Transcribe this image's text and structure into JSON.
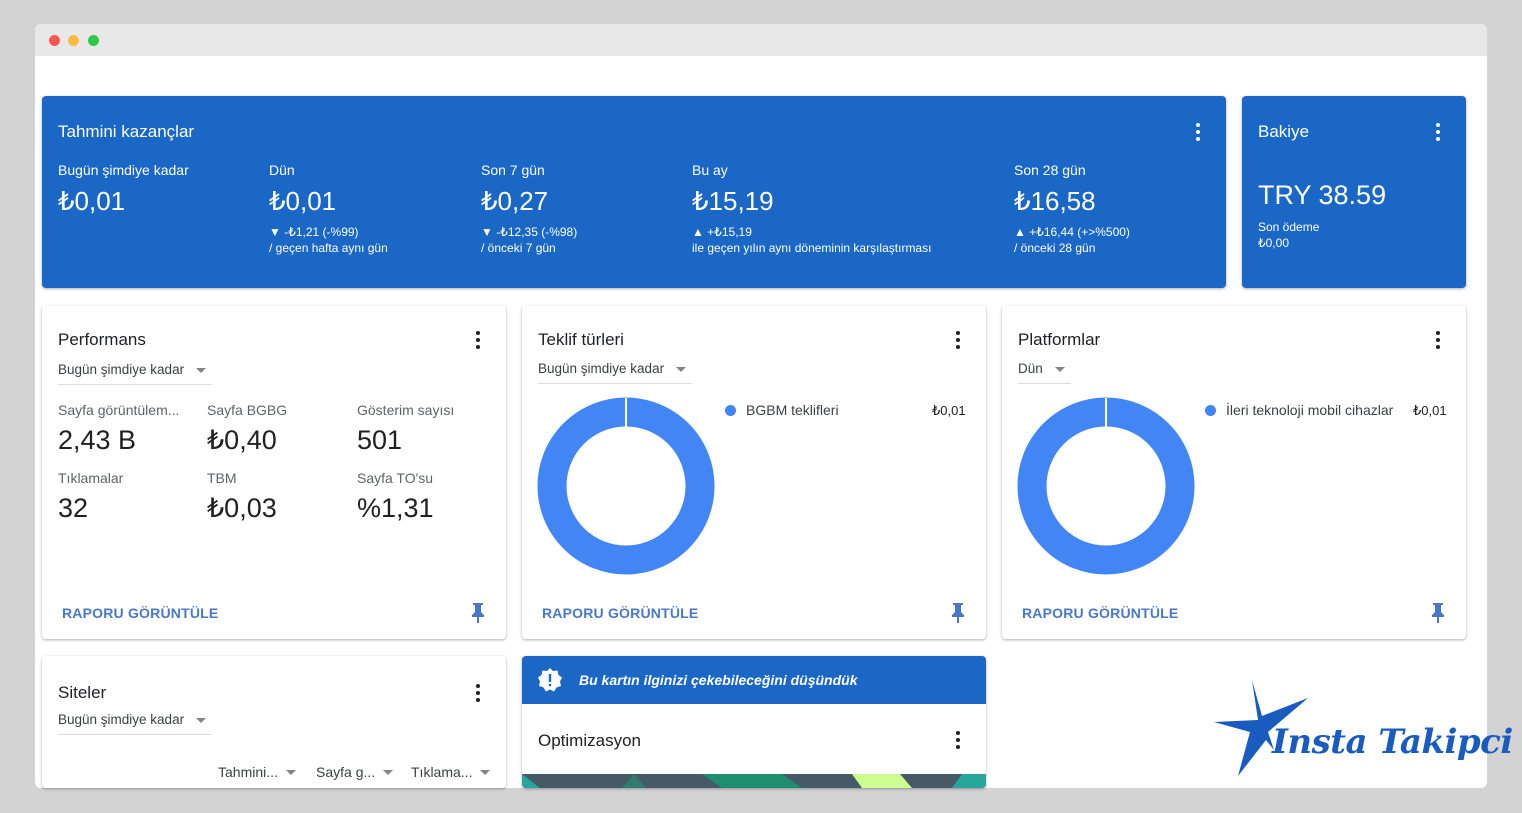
{
  "earnings": {
    "title": "Tahmini kazançlar",
    "columns": [
      {
        "label": "Bugün şimdiye kadar",
        "value": "₺0,01",
        "delta": "",
        "compare": ""
      },
      {
        "label": "Dün",
        "value": "₺0,01",
        "delta": "▼ -₺1,21 (-%99)",
        "compare": "/ geçen hafta aynı gün"
      },
      {
        "label": "Son 7 gün",
        "value": "₺0,27",
        "delta": "▼ -₺12,35 (-%98)",
        "compare": "/ önceki 7 gün"
      },
      {
        "label": "Bu ay",
        "value": "₺15,19",
        "delta": "▲ +₺15,19",
        "compare": "ile geçen yılın aynı döneminin karşılaştırması"
      },
      {
        "label": "Son 28 gün",
        "value": "₺16,58",
        "delta": "▲ +₺16,44 (+>%500)",
        "compare": "/ önceki 28 gün"
      }
    ]
  },
  "balance": {
    "title": "Bakiye",
    "amount": "TRY 38.59",
    "last_payment_label": "Son ödeme",
    "last_payment_value": "₺0,00"
  },
  "performance": {
    "title": "Performans",
    "range": "Bugün şimdiye kadar",
    "metrics": [
      {
        "label": "Sayfa görüntülem...",
        "value": "2,43 B"
      },
      {
        "label": "Sayfa BGBG",
        "value": "₺0,40"
      },
      {
        "label": "Gösterim sayısı",
        "value": "501"
      },
      {
        "label": "Tıklamalar",
        "value": "32"
      },
      {
        "label": "TBM",
        "value": "₺0,03"
      },
      {
        "label": "Sayfa TO'su",
        "value": "%1,31"
      }
    ],
    "report_link": "RAPORU GÖRÜNTÜLE"
  },
  "bid_types": {
    "title": "Teklif türleri",
    "range": "Bugün şimdiye kadar",
    "legend": {
      "label": "BGBM teklifleri",
      "value": "₺0,01"
    },
    "report_link": "RAPORU GÖRÜNTÜLE"
  },
  "platforms": {
    "title": "Platformlar",
    "range": "Dün",
    "legend": {
      "label": "İleri teknoloji mobil cihazlar",
      "value": "₺0,01"
    },
    "report_link": "RAPORU GÖRÜNTÜLE"
  },
  "sites": {
    "title": "Siteler",
    "range": "Bugün şimdiye kadar",
    "columns": [
      "Tahmini...",
      "Sayfa g...",
      "Tıklama..."
    ]
  },
  "optimization": {
    "banner": "Bu kartın ilginizi çekebileceğini düşündük",
    "title": "Optimizasyon"
  },
  "watermark": {
    "text": "Insta Takipci"
  },
  "colors": {
    "primary_blue": "#1a67c6",
    "chart_blue": "#4285f4",
    "link_blue": "#4a78c8"
  }
}
